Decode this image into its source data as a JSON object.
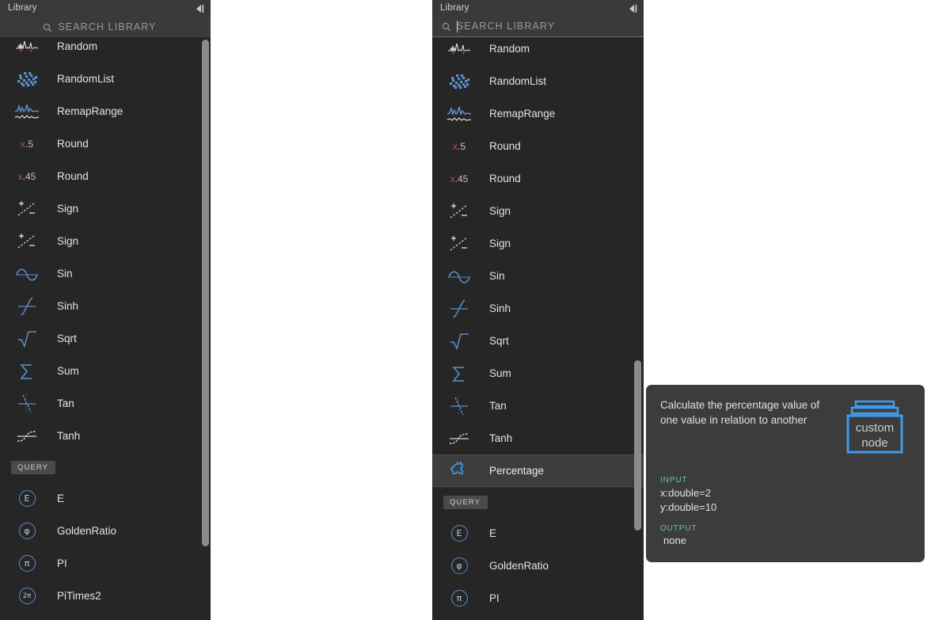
{
  "theme": {
    "panel_bg": "#262626",
    "title_bg": "#393939",
    "search_bg": "#3a3a3a",
    "selection_bg": "#3d3d3d",
    "tooltip_bg": "#3c3c3c",
    "accent_blue": "#5b8fc9",
    "accent_teal": "#63c6a8",
    "text": "#e3e3e3",
    "page_bg": "#ffffff"
  },
  "panel_left": {
    "title": "Library",
    "collapse_icon": "collapse-panel-icon",
    "search": {
      "icon": "search-icon",
      "placeholder": "SEARCH LIBRARY",
      "value": "",
      "focused": false
    },
    "items": [
      {
        "label": "Random",
        "icon": "random-waveform-icon"
      },
      {
        "label": "RandomList",
        "icon": "random-list-icon"
      },
      {
        "label": "RemapRange",
        "icon": "remap-range-icon"
      },
      {
        "label": "Round",
        "icon": "round-half-icon",
        "glyph_x": "x",
        "glyph_d": ".5"
      },
      {
        "label": "Round",
        "icon": "round-decimals-icon",
        "glyph_x": "x",
        "glyph_d": ".45"
      },
      {
        "label": "Sign",
        "icon": "sign-icon"
      },
      {
        "label": "Sign",
        "icon": "sign-icon"
      },
      {
        "label": "Sin",
        "icon": "sin-curve-icon"
      },
      {
        "label": "Sinh",
        "icon": "sinh-curve-icon"
      },
      {
        "label": "Sqrt",
        "icon": "sqrt-radical-icon"
      },
      {
        "label": "Sum",
        "icon": "sum-sigma-icon"
      },
      {
        "label": "Tan",
        "icon": "tan-curve-icon"
      },
      {
        "label": "Tanh",
        "icon": "tanh-curve-icon"
      }
    ],
    "section": {
      "label": "QUERY"
    },
    "query_items": [
      {
        "label": "E",
        "icon": "constant-e-icon",
        "glyph": "E"
      },
      {
        "label": "GoldenRatio",
        "icon": "constant-golden-ratio-icon",
        "glyph": "φ"
      },
      {
        "label": "PI",
        "icon": "constant-pi-icon",
        "glyph": "π"
      },
      {
        "label": "PiTimes2",
        "icon": "constant-pi-times-2-icon",
        "glyph": "2π"
      }
    ]
  },
  "panel_right": {
    "title": "Library",
    "collapse_icon": "collapse-panel-icon",
    "search": {
      "icon": "search-icon",
      "placeholder": "SEARCH LIBRARY",
      "value": "",
      "focused": true
    },
    "items": [
      {
        "label": "Random",
        "icon": "random-waveform-icon"
      },
      {
        "label": "RandomList",
        "icon": "random-list-icon"
      },
      {
        "label": "RemapRange",
        "icon": "remap-range-icon"
      },
      {
        "label": "Round",
        "icon": "round-half-icon",
        "glyph_x": "x",
        "glyph_d": ".5"
      },
      {
        "label": "Round",
        "icon": "round-decimals-icon",
        "glyph_x": "x",
        "glyph_d": ".45"
      },
      {
        "label": "Sign",
        "icon": "sign-icon"
      },
      {
        "label": "Sign",
        "icon": "sign-icon"
      },
      {
        "label": "Sin",
        "icon": "sin-curve-icon"
      },
      {
        "label": "Sinh",
        "icon": "sinh-curve-icon"
      },
      {
        "label": "Sqrt",
        "icon": "sqrt-radical-icon"
      },
      {
        "label": "Sum",
        "icon": "sum-sigma-icon"
      },
      {
        "label": "Tan",
        "icon": "tan-curve-icon"
      },
      {
        "label": "Tanh",
        "icon": "tanh-curve-icon"
      },
      {
        "label": "Percentage",
        "icon": "puzzle-piece-icon",
        "selected": true
      }
    ],
    "section": {
      "label": "QUERY"
    },
    "query_items": [
      {
        "label": "E",
        "icon": "constant-e-icon",
        "glyph": "E"
      },
      {
        "label": "GoldenRatio",
        "icon": "constant-golden-ratio-icon",
        "glyph": "φ"
      },
      {
        "label": "PI",
        "icon": "constant-pi-icon",
        "glyph": "π"
      }
    ]
  },
  "tooltip": {
    "description": "Calculate the percentage value of one value in relation to another",
    "node_icon": "custom-node-icon",
    "node_icon_line1": "custom",
    "node_icon_line2": "node",
    "input_label": "INPUT",
    "inputs": [
      "x:double=2",
      "y:double=10"
    ],
    "output_label": "OUTPUT",
    "output_value": "none"
  }
}
